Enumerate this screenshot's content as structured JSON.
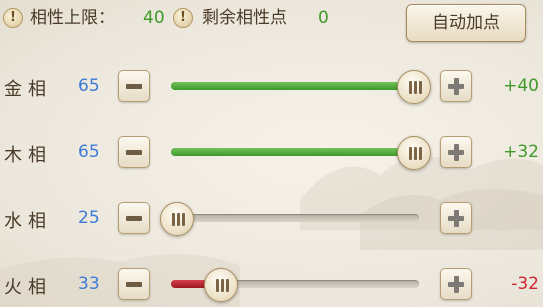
{
  "header": {
    "limit_label": "相性上限：",
    "limit_value": "40",
    "remaining_label": "剩余相性点",
    "remaining_value": "0",
    "info_icon_glyph": "!",
    "auto_button_label": "自动加点"
  },
  "rows": [
    {
      "label": "金相",
      "value": "65",
      "fill_fraction": 0.98,
      "fill_color": "green",
      "delta": "+40",
      "delta_sign": "pos",
      "minus_enabled": true,
      "plus_enabled": true
    },
    {
      "label": "木相",
      "value": "65",
      "fill_fraction": 0.98,
      "fill_color": "green",
      "delta": "+32",
      "delta_sign": "pos",
      "minus_enabled": true,
      "plus_enabled": true
    },
    {
      "label": "水相",
      "value": "25",
      "fill_fraction": 0.0,
      "fill_color": "none",
      "delta": "",
      "delta_sign": "none",
      "minus_enabled": true,
      "plus_enabled": true
    },
    {
      "label": "火相",
      "value": "33",
      "fill_fraction": 0.2,
      "fill_color": "red",
      "delta": "-32",
      "delta_sign": "neg",
      "minus_enabled": true,
      "plus_enabled": true
    }
  ],
  "icons": {
    "info": "info-icon",
    "minus": "minus-icon",
    "plus": "plus-icon",
    "knob": "slider-knob-icon"
  },
  "colors": {
    "positive": "#3f9a2a",
    "negative": "#d02630",
    "value_blue": "#3c7bd6",
    "text": "#4a3a28"
  }
}
